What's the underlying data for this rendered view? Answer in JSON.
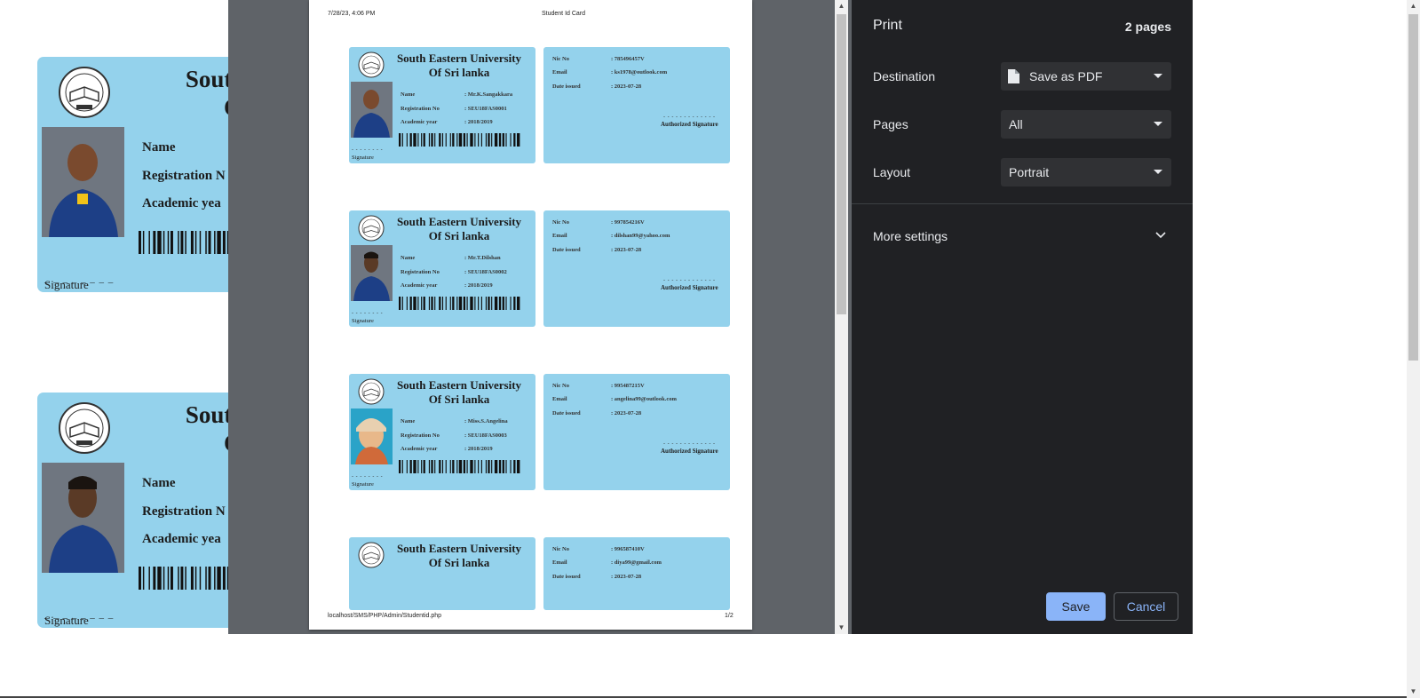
{
  "background_page": {
    "cards": [
      {
        "university_partial": "South Eas",
        "university_line2_partial": "Of",
        "name_label": "Name",
        "reg_label": "Registration N",
        "year_label": "Academic yea",
        "signature_label": "Signature",
        "signature_line": "_ _ _ _ _ _ _ _"
      },
      {
        "university_partial": "South Eas",
        "university_line2_partial": "Of",
        "name_label": "Name",
        "reg_label": "Registration N",
        "year_label": "Academic yea",
        "signature_label": "Signature",
        "signature_line": "_ _ _ _ _ _ _ _"
      }
    ]
  },
  "preview": {
    "header_left": "7/28/23, 4:06 PM",
    "header_center": "Student Id Card",
    "footer_left": "localhost/SMS/PHP/Admin/Studentid.php",
    "footer_right": "1/2",
    "cards": [
      {
        "university": "South Eastern University",
        "university_line2": "Of Sri lanka",
        "name_label": "Name",
        "name": ": Mr.K.Sangakkara",
        "reg_label": "Registration No",
        "reg": ": SEU18FAS0001",
        "year_label": "Academic year",
        "year": ": 2018/2019",
        "signature_label": "Signature",
        "signature_line": "- - - - - - - -",
        "nic_label": "Nic No",
        "nic": ": 785496457V",
        "email_label": "Email",
        "email": ": ks1978@outlook.com",
        "date_label": "Date issued",
        "date": ": 2023-07-28",
        "auth_line": "- - - - - - - - - - - - -",
        "authorized_label": "Authorized Signature"
      },
      {
        "university": "South Eastern University",
        "university_line2": "Of Sri lanka",
        "name_label": "Name",
        "name": ": Mr.T.Dilshan",
        "reg_label": "Registration No",
        "reg": ": SEU18FAS0002",
        "year_label": "Academic year",
        "year": ": 2018/2019",
        "signature_label": "Signature",
        "signature_line": "- - - - - - - -",
        "nic_label": "Nic No",
        "nic": ": 997854216V",
        "email_label": "Email",
        "email": ": dilshan99@yahoo.com",
        "date_label": "Date issued",
        "date": ": 2023-07-28",
        "auth_line": "- - - - - - - - - - - - -",
        "authorized_label": "Authorized Signature"
      },
      {
        "university": "South Eastern University",
        "university_line2": "Of Sri lanka",
        "name_label": "Name",
        "name": ": Miss.S.Angelina",
        "reg_label": "Registration No",
        "reg": ": SEU18FAS0003",
        "year_label": "Academic year",
        "year": ": 2018/2019",
        "signature_label": "Signature",
        "signature_line": "- - - - - - - -",
        "nic_label": "Nic No",
        "nic": ": 995487215V",
        "email_label": "Email",
        "email": ": angelina99@outlook.com",
        "date_label": "Date issued",
        "date": ": 2023-07-28",
        "auth_line": "- - - - - - - - - - - - -",
        "authorized_label": "Authorized Signature"
      },
      {
        "university": "South Eastern University",
        "university_line2": "Of Sri lanka",
        "nic_label": "Nic No",
        "nic": ": 996587410V",
        "email_label": "Email",
        "email": ": diya99@gmail.com",
        "date_label": "Date issued",
        "date": ": 2023-07-28"
      }
    ]
  },
  "print_panel": {
    "title": "Print",
    "pages_count": "2 pages",
    "destination_label": "Destination",
    "destination_value": "Save as PDF",
    "pages_label": "Pages",
    "pages_value": "All",
    "layout_label": "Layout",
    "layout_value": "Portrait",
    "more_settings": "More settings",
    "save_button": "Save",
    "cancel_button": "Cancel"
  },
  "colors": {
    "card_blue": "#94d2ec",
    "panel_bg": "#202124",
    "accent": "#8ab4f8",
    "preview_bg": "#5f6368"
  },
  "icons": [
    "document-icon",
    "dropdown-caret-icon",
    "chevron-down-icon",
    "university-crest-icon",
    "student-photo",
    "barcode"
  ]
}
